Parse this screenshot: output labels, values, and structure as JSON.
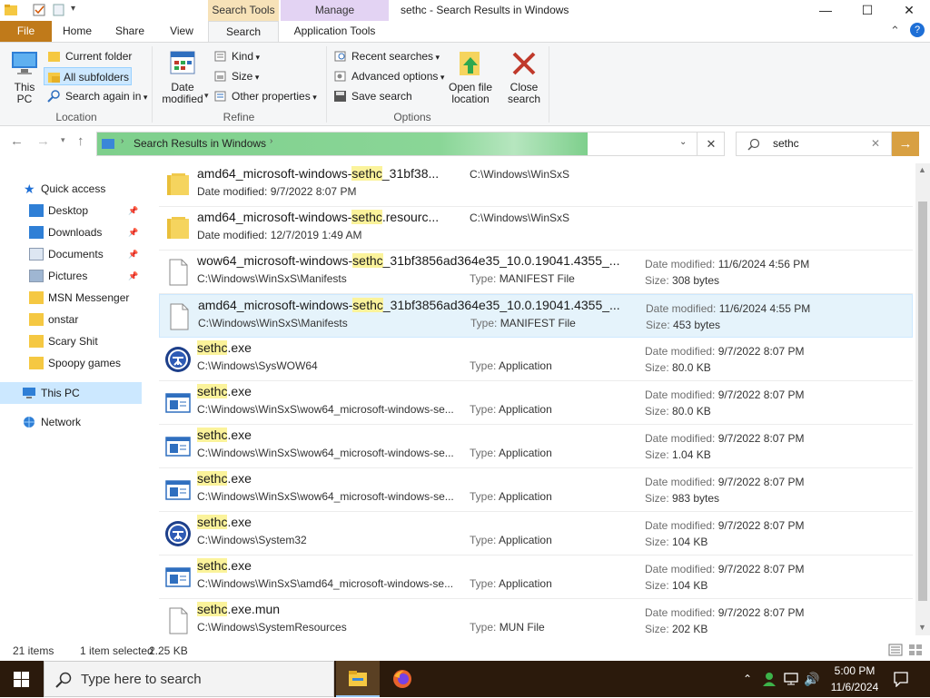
{
  "window": {
    "title": "sethc - Search Results in Windows",
    "context_tabs": {
      "search_tools": "Search Tools",
      "manage": "Manage"
    },
    "controls": {
      "minimize": "—",
      "maximize": "☐",
      "close": "✕"
    }
  },
  "tabs": [
    {
      "label": "File"
    },
    {
      "label": "Home"
    },
    {
      "label": "Share"
    },
    {
      "label": "View"
    },
    {
      "label": "Search"
    },
    {
      "label": "Application Tools"
    }
  ],
  "ribbon": {
    "location": {
      "this_pc": "This\nPC",
      "current_folder": "Current folder",
      "all_subfolders": "All subfolders",
      "search_again_in": "Search again in",
      "group_label": "Location"
    },
    "refine": {
      "date_modified": "Date\nmodified",
      "kind": "Kind",
      "size": "Size",
      "other_properties": "Other properties",
      "group_label": "Refine"
    },
    "options": {
      "recent_searches": "Recent searches",
      "advanced_options": "Advanced options",
      "save_search": "Save search",
      "open_file_location": "Open file\nlocation",
      "close_search": "Close\nsearch",
      "group_label": "Options"
    }
  },
  "address": {
    "breadcrumb": "Search Results in Windows",
    "search_value": "sethc"
  },
  "nav": {
    "quick_access": "Quick access",
    "items": [
      {
        "label": "Desktop",
        "icon": "desktop-icon",
        "pinned": true
      },
      {
        "label": "Downloads",
        "icon": "downloads-icon",
        "pinned": true
      },
      {
        "label": "Documents",
        "icon": "documents-icon",
        "pinned": true
      },
      {
        "label": "Pictures",
        "icon": "pictures-icon",
        "pinned": true
      },
      {
        "label": "MSN Messenger",
        "icon": "folder-icon",
        "pinned": false
      },
      {
        "label": "onstar",
        "icon": "folder-icon",
        "pinned": false
      },
      {
        "label": "Scary Shit",
        "icon": "folder-icon",
        "pinned": false
      },
      {
        "label": "Spoopy games",
        "icon": "folder-icon",
        "pinned": false
      }
    ],
    "this_pc": "This PC",
    "network": "Network"
  },
  "results": [
    {
      "icon": "folder-icon",
      "pre": "amd64_microsoft-windows-",
      "hl": "sethc",
      "post": "_31bf38...",
      "sub": "Date modified: 9/7/2022 8:07 PM",
      "col2": "C:\\Windows\\WinSxS",
      "col2_type": "path",
      "date": "",
      "size": "",
      "selected": false
    },
    {
      "icon": "folder-icon",
      "pre": "amd64_microsoft-windows-",
      "hl": "sethc",
      "post": ".resourc...",
      "sub": "Date modified: 12/7/2019 1:49 AM",
      "col2": "C:\\Windows\\WinSxS",
      "col2_type": "path",
      "date": "",
      "size": "",
      "selected": false
    },
    {
      "icon": "file-icon",
      "pre": "wow64_microsoft-windows-",
      "hl": "sethc",
      "post": "_31bf3856ad364e35_10.0.19041.4355_...",
      "sub": "C:\\Windows\\WinSxS\\Manifests",
      "col2": "MANIFEST File",
      "col2_type": "type",
      "date": "11/6/2024 4:56 PM",
      "size": "308 bytes",
      "selected": false
    },
    {
      "icon": "file-icon",
      "pre": "amd64_microsoft-windows-",
      "hl": "sethc",
      "post": "_31bf3856ad364e35_10.0.19041.4355_...",
      "sub": "C:\\Windows\\WinSxS\\Manifests",
      "col2": "MANIFEST File",
      "col2_type": "type",
      "date": "11/6/2024 4:55 PM",
      "size": "453 bytes",
      "selected": true
    },
    {
      "icon": "ease-of-access-icon",
      "pre": "",
      "hl": "sethc",
      "post": ".exe",
      "sub": "C:\\Windows\\SysWOW64",
      "col2": "Application",
      "col2_type": "type",
      "date": "9/7/2022 8:07 PM",
      "size": "80.0 KB",
      "selected": false
    },
    {
      "icon": "app-window-icon",
      "pre": "",
      "hl": "sethc",
      "post": ".exe",
      "sub": "C:\\Windows\\WinSxS\\wow64_microsoft-windows-se...",
      "col2": "Application",
      "col2_type": "type",
      "date": "9/7/2022 8:07 PM",
      "size": "80.0 KB",
      "selected": false
    },
    {
      "icon": "app-window-icon",
      "pre": "",
      "hl": "sethc",
      "post": ".exe",
      "sub": "C:\\Windows\\WinSxS\\wow64_microsoft-windows-se...",
      "col2": "Application",
      "col2_type": "type",
      "date": "9/7/2022 8:07 PM",
      "size": "1.04 KB",
      "selected": false
    },
    {
      "icon": "app-window-icon",
      "pre": "",
      "hl": "sethc",
      "post": ".exe",
      "sub": "C:\\Windows\\WinSxS\\wow64_microsoft-windows-se...",
      "col2": "Application",
      "col2_type": "type",
      "date": "9/7/2022 8:07 PM",
      "size": "983 bytes",
      "selected": false
    },
    {
      "icon": "ease-of-access-icon",
      "pre": "",
      "hl": "sethc",
      "post": ".exe",
      "sub": "C:\\Windows\\System32",
      "col2": "Application",
      "col2_type": "type",
      "date": "9/7/2022 8:07 PM",
      "size": "104 KB",
      "selected": false
    },
    {
      "icon": "app-window-icon",
      "pre": "",
      "hl": "sethc",
      "post": ".exe",
      "sub": "C:\\Windows\\WinSxS\\amd64_microsoft-windows-se...",
      "col2": "Application",
      "col2_type": "type",
      "date": "9/7/2022 8:07 PM",
      "size": "104 KB",
      "selected": false
    },
    {
      "icon": "file-icon",
      "pre": "",
      "hl": "sethc",
      "post": ".exe.mun",
      "sub": "C:\\Windows\\SystemResources",
      "col2": "MUN File",
      "col2_type": "type",
      "date": "9/7/2022 8:07 PM",
      "size": "202 KB",
      "selected": false
    }
  ],
  "labels": {
    "date_modified": "Date modified: ",
    "type": "Type: ",
    "size": "Size: "
  },
  "status": {
    "items": "21 items",
    "selected": "1 item selected",
    "size": "2.25 KB"
  },
  "taskbar": {
    "search_placeholder": "Type here to search",
    "time": "5:00 PM",
    "date": "11/6/2024"
  },
  "colors": {
    "file_tab": "#c07a1a",
    "search_tools_tab": "#f7e2b8",
    "manage_tab": "#e3d3f3",
    "address_fill": "#7ecf8c",
    "search_go": "#d8a042",
    "highlight": "#fbf39b",
    "selection": "#e5f3fb"
  }
}
